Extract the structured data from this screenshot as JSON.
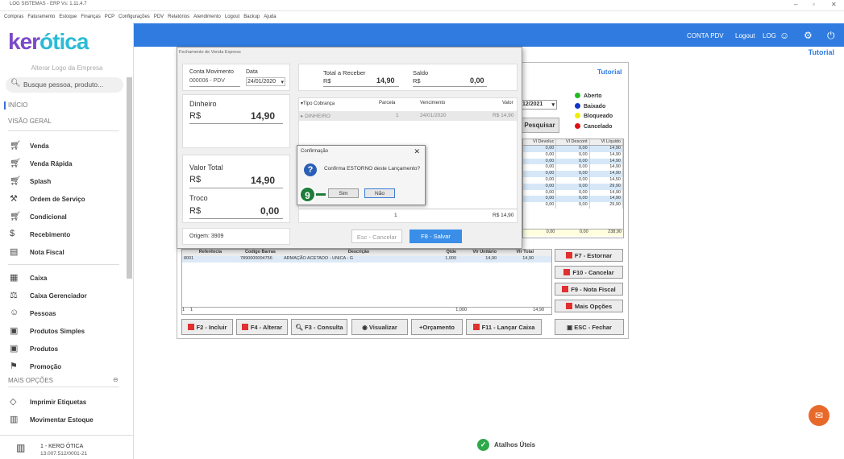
{
  "window": {
    "title": "LOG SISTEMAS - ERP Vs: 1.11.4.7",
    "min": "–",
    "max": "▫",
    "close": "✕"
  },
  "menu": [
    "Compras",
    "Faturamento",
    "Estoque",
    "Finanças",
    "PCP",
    "Configurações",
    "PDV",
    "Relatórios",
    "Atendimento",
    "Logout",
    "Backup",
    "Ajuda"
  ],
  "sidebar": {
    "logo_a": "ker",
    "logo_b": "ótica",
    "alter_logo": "Alterar Logo da Empresa",
    "search_placeholder": "Busque pessoa, produto...",
    "inicio": "INÍCIO",
    "visao_geral": "VISÃO GERAL",
    "items": [
      {
        "label": "Venda",
        "icon": "cart-icon"
      },
      {
        "label": "Venda Rápida",
        "icon": "cart-icon"
      },
      {
        "label": "Splash",
        "icon": "cart-icon"
      },
      {
        "label": "Ordem de Serviço",
        "icon": "wrench-icon"
      },
      {
        "label": "Condicional",
        "icon": "cart-icon"
      },
      {
        "label": "Recebimento",
        "icon": "money-icon"
      },
      {
        "label": "Nota Fiscal",
        "icon": "invoice-icon"
      },
      {
        "label": "Caixa",
        "icon": "register-icon"
      },
      {
        "label": "Caixa Gerenciador",
        "icon": "scale-icon"
      },
      {
        "label": "Pessoas",
        "icon": "people-icon"
      },
      {
        "label": "Produtos Simples",
        "icon": "box-icon"
      },
      {
        "label": "Produtos",
        "icon": "box-icon"
      },
      {
        "label": "Promoção",
        "icon": "tag-icon"
      }
    ],
    "mais_opcoes": "MAIS OPÇÕES",
    "more_items": [
      {
        "label": "Imprimir Etiquetas",
        "icon": "label-icon"
      },
      {
        "label": "Movimentar Estoque",
        "icon": "truck-icon"
      }
    ],
    "store_name": "1 - KERO ÓTICA",
    "store_cnpj": "13.007.512/0001-21"
  },
  "topbar": {
    "conta_pdv": "CONTA PDV",
    "logout": "Logout",
    "user": "LOG",
    "tutorial": "Tutorial"
  },
  "main": {
    "tutorial": "Tutorial",
    "date_value": "12/2021",
    "pesquisar": "Pesquisar",
    "legend": [
      {
        "label": "Aberto",
        "color": "#22bb22"
      },
      {
        "label": "Baixado",
        "color": "#1133cc"
      },
      {
        "label": "Bloqueado",
        "color": "#eeee00"
      },
      {
        "label": "Cancelado",
        "color": "#dd1111"
      }
    ],
    "grid_headers": [
      "Vl Devoluc",
      "Vl Descont",
      "Vl Líquido"
    ],
    "grid_rows": [
      [
        "0,00",
        "0,00",
        "14,90"
      ],
      [
        "0,00",
        "0,00",
        "14,90"
      ],
      [
        "0,00",
        "0,00",
        "14,90"
      ],
      [
        "0,00",
        "0,00",
        "14,90"
      ],
      [
        "0,00",
        "0,00",
        "14,90"
      ],
      [
        "0,00",
        "0,00",
        "14,50"
      ],
      [
        "0,00",
        "0,00",
        "29,90"
      ],
      [
        "0,00",
        "0,00",
        "14,90"
      ],
      [
        "0,00",
        "0,00",
        "14,90"
      ],
      [
        "0,00",
        "0,00",
        "29,90"
      ]
    ],
    "grid_total": [
      "0,00",
      "0,00",
      "238,90"
    ],
    "side_buttons": [
      "F7 - Estornar",
      "F10 - Cancelar",
      "F9 - Nota Fiscal",
      "Mais Opções"
    ],
    "items_headers": [
      "Referência",
      "Codigo Barras",
      "Descrição",
      "Qtde",
      "Vlr Unitário",
      "Vlr Total"
    ],
    "items_row": [
      "8001",
      "7890000004756",
      "ARMAÇÃO ACETADO - UNICA - G",
      "1,000",
      "14,90",
      "14,90"
    ],
    "items_footer": [
      "1",
      "1",
      "1,000",
      "14,90"
    ],
    "bottom_buttons": [
      "F2 - Incluir",
      "F4 - Alterar",
      "F3 - Consulta",
      "Visualizar",
      "+Orçamento",
      "F11 - Lançar Caixa",
      "ESC - Fechar"
    ]
  },
  "dialog": {
    "title": "Fechamento de Venda Express",
    "conta_label": "Conta Movimento",
    "conta_value": "000006 - PDV",
    "data_label": "Data",
    "data_value": "24/01/2020",
    "total_receber_label": "Total a Receber",
    "currency": "R$",
    "total_receber": "14,90",
    "saldo_label": "Saldo",
    "saldo": "0,00",
    "dinheiro_label": "Dinheiro",
    "dinheiro": "14,90",
    "valor_total_label": "Valor Total",
    "valor_total": "14,90",
    "troco_label": "Troco",
    "troco": "0,00",
    "origem": "Origem: 3909",
    "grid_headers": [
      "Tipo Cobrança",
      "Parcela",
      "Vencimento",
      "Valor"
    ],
    "grid_row": [
      "DINHEIRO",
      "1",
      "24/01/2020",
      "R$ 14,90"
    ],
    "grid_footer": [
      "1",
      "R$ 14,90"
    ],
    "esc_cancelar": "Esc - Cancelar",
    "f8_salvar": "F8 - Salvar"
  },
  "confirm": {
    "title": "Confirmação",
    "message": "Confirma ESTORNO deste Lançamento?",
    "sim": "Sim",
    "nao": "Não",
    "step": "9"
  },
  "footer": {
    "atalhos": "Atalhos Úteis"
  }
}
